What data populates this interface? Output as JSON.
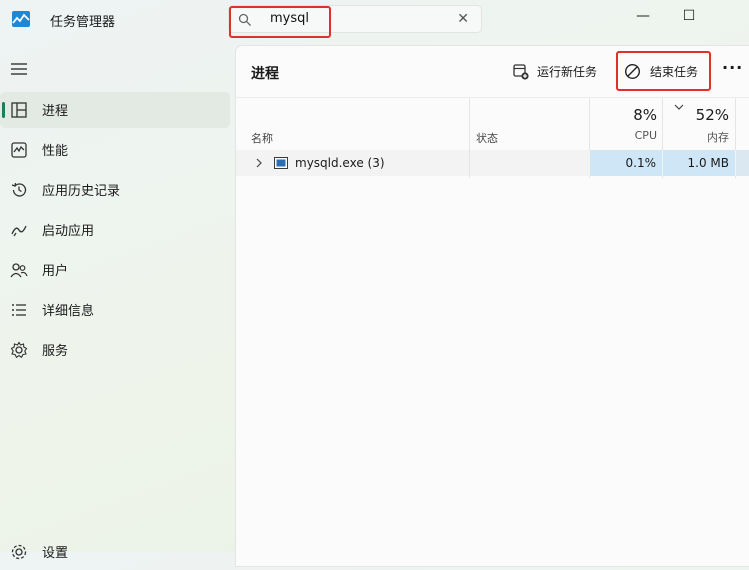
{
  "app": {
    "title": "任务管理器"
  },
  "search": {
    "value": "mysql",
    "clear_icon": "close-icon"
  },
  "window_controls": {
    "minimize": "—",
    "maximize": "☐"
  },
  "nav": {
    "items": [
      {
        "label": "进程",
        "icon": "processes-icon",
        "active": true
      },
      {
        "label": "性能",
        "icon": "performance-icon"
      },
      {
        "label": "应用历史记录",
        "icon": "history-icon"
      },
      {
        "label": "启动应用",
        "icon": "startup-icon"
      },
      {
        "label": "用户",
        "icon": "users-icon"
      },
      {
        "label": "详细信息",
        "icon": "details-icon"
      },
      {
        "label": "服务",
        "icon": "services-icon"
      }
    ],
    "settings_label": "设置"
  },
  "toolbar": {
    "page_title": "进程",
    "run_new_task": "运行新任务",
    "end_task": "结束任务",
    "more": "···"
  },
  "table": {
    "columns": {
      "name": "名称",
      "status": "状态"
    },
    "cpu": {
      "percent": "8%",
      "label": "CPU"
    },
    "memory": {
      "percent": "52%",
      "label": "内存"
    },
    "rows": [
      {
        "name": "mysqld.exe (3)",
        "status": "",
        "cpu": "0.1%",
        "memory": "1.0 MB"
      }
    ]
  },
  "colors": {
    "highlight": "#e0302a",
    "accent": "#1a7f5a",
    "cell_heat": "#cfe6f6"
  }
}
